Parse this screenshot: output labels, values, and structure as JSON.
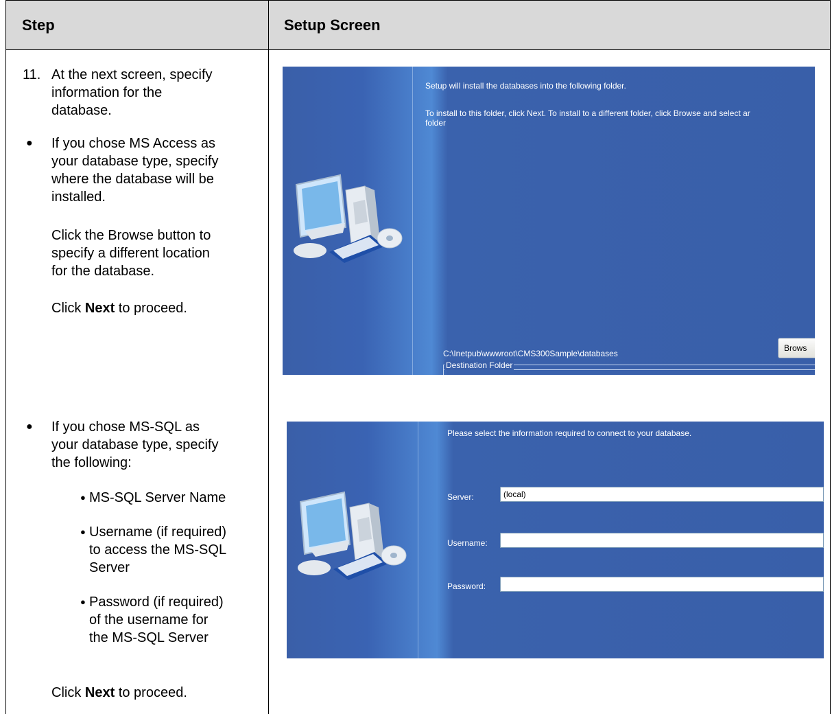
{
  "header": {
    "step": "Step",
    "setup_screen": "Setup Screen"
  },
  "left": {
    "step11_number": "11.",
    "step11_text_l1": "At the next screen, specify",
    "step11_text_l2": "information for the",
    "step11_text_l3": "database.",
    "access_l1": "If you chose MS Access as",
    "access_l2": "your database type, specify",
    "access_l3": "where the database will be",
    "access_l4": "installed.",
    "browse_l1": "Click the Browse button to",
    "browse_l2": "specify a different location",
    "browse_l3": "for the database.",
    "click_next_1_prefix": "Click ",
    "click_next_1_bold": "Next",
    "click_next_1_suffix": " to proceed.",
    "sql_l1": "If you chose MS-SQL as",
    "sql_l2": "your database type, specify",
    "sql_l3": "the following:",
    "sub1": "MS-SQL Server Name",
    "sub2_l1": "Username (if required)",
    "sub2_l2": "to access the MS-SQL",
    "sub2_l3": "Server",
    "sub3_l1": "Password (if required)",
    "sub3_l2": "of the username for",
    "sub3_l3": "the MS-SQL Server",
    "click_next_2_prefix": "Click ",
    "click_next_2_bold": "Next",
    "click_next_2_suffix": " to proceed."
  },
  "screen1": {
    "line1": "Setup will install the databases into the following folder.",
    "line2": "To install to this folder, click Next. To install to a different folder, click Browse and select ar",
    "line3": "folder",
    "group_label": "Destination Folder",
    "path": "C:\\Inetpub\\wwwroot\\CMS300Sample\\databases",
    "browse_button": "Brows"
  },
  "screen2": {
    "prompt": "Please select the information required to connect to your database.",
    "server_label": "Server:",
    "server_value": "(local)",
    "username_label": "Username:",
    "username_value": "",
    "password_label": "Password:",
    "password_value": ""
  },
  "icons": {
    "computer": "computer-with-cd-icon",
    "bullet": "bullet-icon"
  }
}
